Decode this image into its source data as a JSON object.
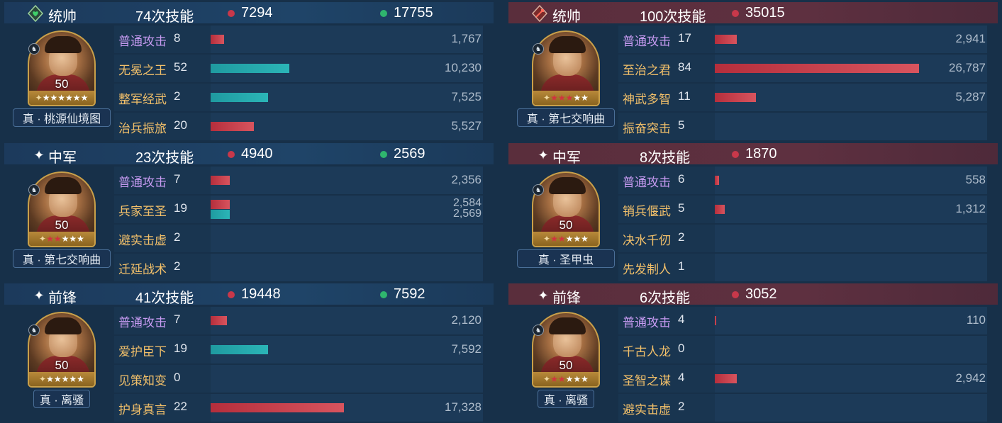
{
  "colors": {
    "left_header": "#1f4468",
    "right_header": "#5e3040",
    "damage_bar": "#c8384a",
    "heal_bar": "#2bb5b7",
    "attack_label": "#c79bf2",
    "skill_label": "#f2c06a"
  },
  "left": [
    {
      "role": "统帅",
      "role_icon": "heart-shield-icon",
      "skills": "74次技能",
      "damage": "7294",
      "heal": "17755",
      "level": "50",
      "gear": "真 · 桃源仙境图",
      "stars": {
        "white": 6,
        "red": 0
      },
      "mount": "horse-icon",
      "rows": [
        {
          "name": "普通攻击",
          "count": "8",
          "value": "1,767",
          "bar": 0.05,
          "color": "red",
          "type": "atk"
        },
        {
          "name": "无冕之王",
          "count": "52",
          "value": "10,230",
          "bar": 0.29,
          "color": "teal",
          "type": "skill"
        },
        {
          "name": "整军经武",
          "count": "2",
          "value": "7,525",
          "bar": 0.21,
          "color": "teal",
          "type": "skill"
        },
        {
          "name": "治兵振旅",
          "count": "20",
          "value": "5,527",
          "bar": 0.16,
          "color": "red",
          "type": "skill"
        }
      ]
    },
    {
      "role": "中军",
      "role_icon": "star-icon",
      "skills": "23次技能",
      "damage": "4940",
      "heal": "2569",
      "level": "50",
      "gear": "真 · 第七交响曲",
      "stars": {
        "white": 3,
        "red": 2
      },
      "mount": "horse-icon",
      "rows": [
        {
          "name": "普通攻击",
          "count": "7",
          "value": "2,356",
          "bar": 0.07,
          "color": "red",
          "type": "atk"
        },
        {
          "name": "兵家至圣",
          "count": "19",
          "value": "2,584",
          "value2": "2,569",
          "bar": 0.07,
          "color": "red",
          "bar2": 0.07,
          "color2": "teal",
          "type": "skill"
        },
        {
          "name": "避实击虚",
          "count": "2",
          "value": "",
          "bar": 0,
          "color": "red",
          "type": "skill"
        },
        {
          "name": "迁延战术",
          "count": "2",
          "value": "",
          "bar": 0,
          "color": "red",
          "type": "skill"
        }
      ]
    },
    {
      "role": "前锋",
      "role_icon": "star-icon",
      "skills": "41次技能",
      "damage": "19448",
      "heal": "7592",
      "level": "50",
      "gear": "真 · 离骚",
      "stars": {
        "white": 5,
        "red": 0
      },
      "mount": "horse-icon",
      "rows": [
        {
          "name": "普通攻击",
          "count": "7",
          "value": "2,120",
          "bar": 0.06,
          "color": "red",
          "type": "atk"
        },
        {
          "name": "爱护臣下",
          "count": "19",
          "value": "7,592",
          "bar": 0.21,
          "color": "teal",
          "type": "skill"
        },
        {
          "name": "见策知变",
          "count": "0",
          "value": "",
          "bar": 0,
          "color": "red",
          "type": "skill"
        },
        {
          "name": "护身真言",
          "count": "22",
          "value": "17,328",
          "bar": 0.49,
          "color": "red",
          "type": "skill"
        }
      ]
    }
  ],
  "right": [
    {
      "role": "统帅",
      "role_icon": "sword-icon",
      "skills": "100次技能",
      "damage": "35015",
      "heal": "",
      "level": "",
      "gear": "真 · 第七交响曲",
      "stars": {
        "white": 2,
        "red": 3
      },
      "mount": "horse-icon",
      "rows": [
        {
          "name": "普通攻击",
          "count": "17",
          "value": "2,941",
          "bar": 0.08,
          "color": "red",
          "type": "atk"
        },
        {
          "name": "至治之君",
          "count": "84",
          "value": "26,787",
          "bar": 0.75,
          "color": "red",
          "type": "skill"
        },
        {
          "name": "神武多智",
          "count": "11",
          "value": "5,287",
          "bar": 0.15,
          "color": "red",
          "type": "skill"
        },
        {
          "name": "振奋突击",
          "count": "5",
          "value": "",
          "bar": 0,
          "color": "red",
          "type": "skill"
        }
      ]
    },
    {
      "role": "中军",
      "role_icon": "star-icon",
      "skills": "8次技能",
      "damage": "1870",
      "heal": "",
      "level": "50",
      "gear": "真 · 圣甲虫",
      "stars": {
        "white": 3,
        "red": 2
      },
      "mount": "horse-icon",
      "rows": [
        {
          "name": "普通攻击",
          "count": "6",
          "value": "558",
          "bar": 0.016,
          "color": "red",
          "type": "atk"
        },
        {
          "name": "销兵偃武",
          "count": "5",
          "value": "1,312",
          "bar": 0.037,
          "color": "red",
          "type": "skill"
        },
        {
          "name": "决水千仞",
          "count": "2",
          "value": "",
          "bar": 0,
          "color": "red",
          "type": "skill"
        },
        {
          "name": "先发制人",
          "count": "1",
          "value": "",
          "bar": 0,
          "color": "red",
          "type": "skill"
        }
      ]
    },
    {
      "role": "前锋",
      "role_icon": "star-icon",
      "skills": "6次技能",
      "damage": "3052",
      "heal": "",
      "level": "50",
      "gear": "真 · 离骚",
      "stars": {
        "white": 3,
        "red": 2
      },
      "mount": "horse-icon",
      "rows": [
        {
          "name": "普通攻击",
          "count": "4",
          "value": "110",
          "bar": 0.004,
          "color": "red",
          "type": "atk"
        },
        {
          "name": "千古人龙",
          "count": "0",
          "value": "",
          "bar": 0,
          "color": "red",
          "type": "skill"
        },
        {
          "name": "圣智之谋",
          "count": "4",
          "value": "2,942",
          "bar": 0.08,
          "color": "red",
          "type": "skill"
        },
        {
          "name": "避实击虚",
          "count": "2",
          "value": "",
          "bar": 0,
          "color": "red",
          "type": "skill"
        }
      ]
    }
  ]
}
